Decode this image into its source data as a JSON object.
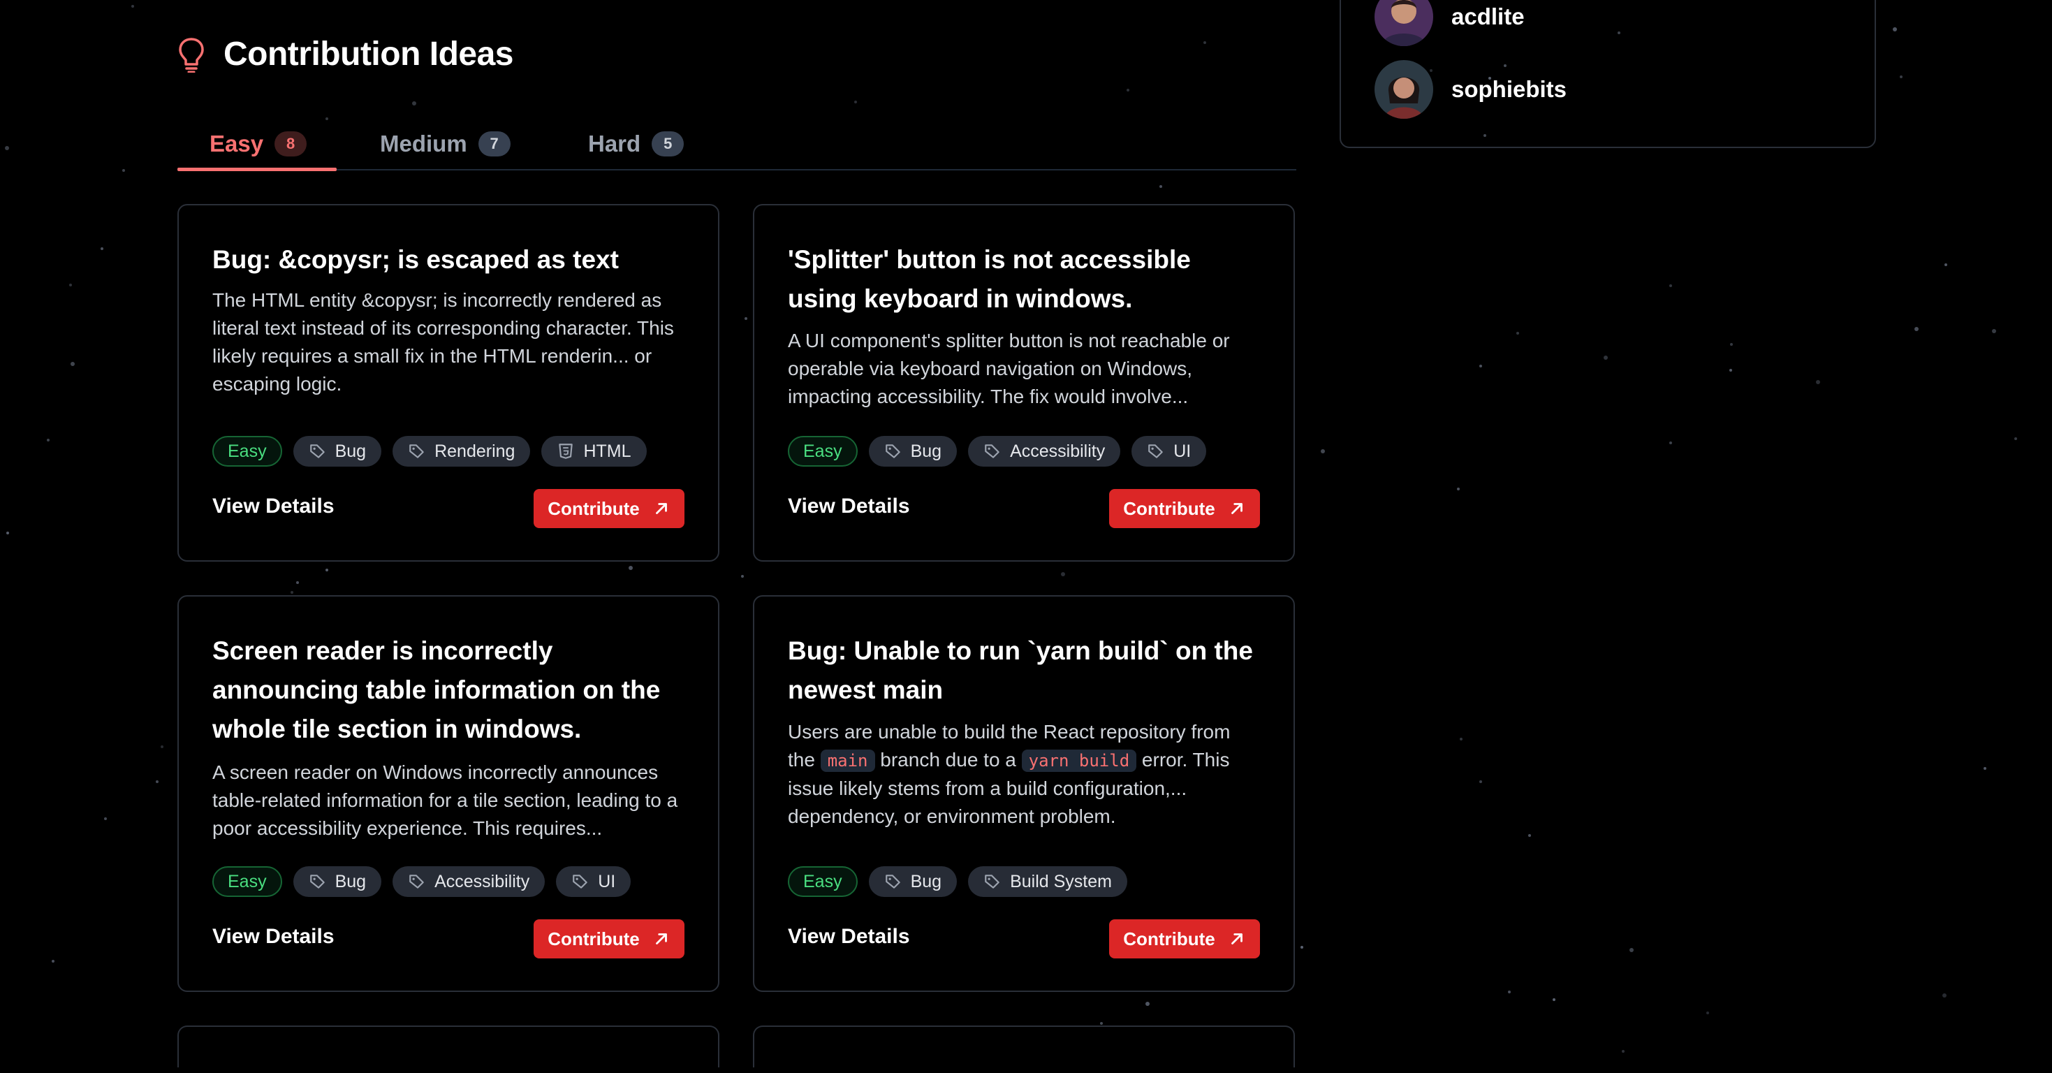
{
  "header": {
    "title": "Contribution Ideas",
    "icon": "lightbulb-icon",
    "accent": "#f87171"
  },
  "tabs": [
    {
      "label": "Easy",
      "count": "8",
      "active": true
    },
    {
      "label": "Medium",
      "count": "7",
      "active": false
    },
    {
      "label": "Hard",
      "count": "5",
      "active": false
    }
  ],
  "contributors": [
    {
      "name": "acdlite"
    },
    {
      "name": "sophiebits"
    }
  ],
  "cards": [
    {
      "title": "Bug: &copysr; is escaped as text",
      "description": "The HTML entity &copysr; is incorrectly rendered as literal text instead of its corresponding character. This likely requires a small fix in the HTML renderin... or escaping logic.",
      "difficulty": "Easy",
      "tags": [
        {
          "label": "Bug",
          "icon": "tag-icon"
        },
        {
          "label": "Rendering",
          "icon": "tag-icon"
        },
        {
          "label": "HTML",
          "icon": "html5-icon"
        }
      ],
      "view_label": "View Details",
      "contribute_label": "Contribute"
    },
    {
      "title": "'Splitter' button is not accessible using keyboard in windows.",
      "description": "A UI component's splitter button is not reachable or operable via keyboard navigation on Windows, impacting accessibility. The fix would involve...",
      "difficulty": "Easy",
      "tags": [
        {
          "label": "Bug",
          "icon": "tag-icon"
        },
        {
          "label": "Accessibility",
          "icon": "tag-icon"
        },
        {
          "label": "UI",
          "icon": "tag-icon"
        }
      ],
      "view_label": "View Details",
      "contribute_label": "Contribute"
    },
    {
      "title": "Screen reader is incorrectly announcing table information on the whole tile section in windows.",
      "description": "A screen reader on Windows incorrectly announces table-related information for a tile section, leading to a poor accessibility experience. This requires...",
      "difficulty": "Easy",
      "tags": [
        {
          "label": "Bug",
          "icon": "tag-icon"
        },
        {
          "label": "Accessibility",
          "icon": "tag-icon"
        },
        {
          "label": "UI",
          "icon": "tag-icon"
        }
      ],
      "view_label": "View Details",
      "contribute_label": "Contribute"
    },
    {
      "title": "Bug: Unable to run `yarn build` on the newest main",
      "description_parts": [
        "Users are unable to build the React repository from the ",
        "main",
        " branch due to a ",
        "yarn build",
        " error. This issue likely stems from a build configuration,... dependency, or environment problem."
      ],
      "difficulty": "Easy",
      "tags": [
        {
          "label": "Bug",
          "icon": "tag-icon"
        },
        {
          "label": "Build System",
          "icon": "tag-icon"
        }
      ],
      "view_label": "View Details",
      "contribute_label": "Contribute"
    }
  ],
  "partial_cards": [
    {
      "title_fragment": ""
    },
    {
      "title_fragment": ""
    }
  ]
}
